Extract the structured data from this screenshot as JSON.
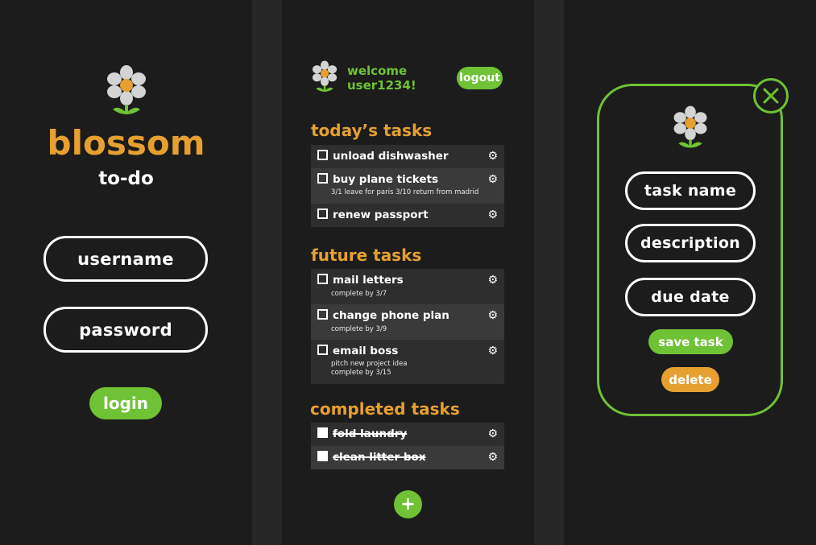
{
  "colors": {
    "accent_green": "#6fc235",
    "accent_orange": "#e6a030",
    "background": "#1c1c1c"
  },
  "login": {
    "brand": "blossom",
    "subtitle": "to-do",
    "username_placeholder": "username",
    "password_placeholder": "password",
    "login_label": "login"
  },
  "list": {
    "welcome": "welcome",
    "user": "user1234!",
    "logout_label": "logout",
    "today_title": "today’s tasks",
    "today": [
      {
        "name": "unload dishwasher",
        "sub": ""
      },
      {
        "name": "buy plane tickets",
        "sub": "3/1 leave for paris 3/10 return from madrid"
      },
      {
        "name": "renew passport",
        "sub": ""
      }
    ],
    "future_title": "future tasks",
    "future": [
      {
        "name": "mail letters",
        "sub1": "complete by 3/7"
      },
      {
        "name": "change phone plan",
        "sub1": "complete by 3/9"
      },
      {
        "name": "email boss",
        "sub1": "pitch new project idea",
        "sub2": "complete by 3/15"
      }
    ],
    "completed_title": "completed tasks",
    "completed": [
      {
        "name": "fold laundry"
      },
      {
        "name": "clean litter box"
      }
    ],
    "add_icon": "plus-icon"
  },
  "editor": {
    "task_name_placeholder": "task name",
    "description_placeholder": "description",
    "due_date_placeholder": "due date",
    "save_label": "save task",
    "delete_label": "delete",
    "close_icon": "close-icon"
  }
}
